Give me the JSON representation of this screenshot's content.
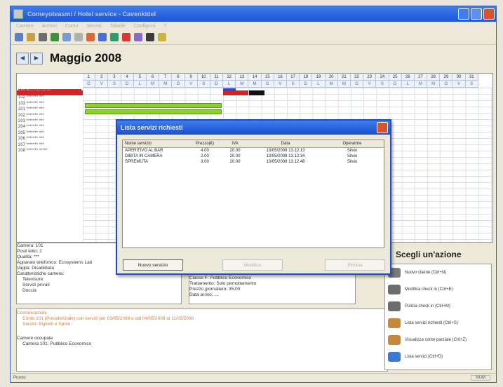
{
  "window": {
    "title": "Comeyoteasmi / Hotel service - Cavenkidel"
  },
  "menu": [
    "Camere",
    "Archivi",
    "Conto",
    "Servizi",
    "Tabelle",
    "Configura",
    "?"
  ],
  "calendar": {
    "month": "Maggio 2008",
    "days": [
      "1",
      "2",
      "3",
      "4",
      "5",
      "6",
      "7",
      "8",
      "9",
      "10",
      "11",
      "12",
      "13",
      "14",
      "15",
      "16",
      "17",
      "18",
      "19",
      "20",
      "21",
      "22",
      "23",
      "24",
      "25",
      "26",
      "27",
      "28",
      "29",
      "30",
      "31"
    ],
    "weekdays": [
      "G",
      "V",
      "S",
      "D",
      "L",
      "M",
      "M",
      "G",
      "V",
      "S",
      "D",
      "L",
      "M",
      "M",
      "G",
      "V",
      "S",
      "D",
      "L",
      "M",
      "M",
      "G",
      "V",
      "S",
      "D",
      "L",
      "M",
      "M",
      "G",
      "V",
      "S"
    ],
    "rooms": [
      "101 Presidenziale",
      "102 ******* ***",
      "103 ******* ***",
      "201 ******* ***",
      "202 ******* ***",
      "203 ******* ***",
      "204 ******* ***",
      "205 ******* ***",
      "206 ******* ***",
      "207 ******* ***",
      "208 ******* *****"
    ]
  },
  "room_info": {
    "lines": [
      "Camera: 101",
      "Posti letto: 2",
      "Qualità: ***",
      "Apparato telefonico: Ecosystems Lab",
      "Vaglia: Disabilitata",
      "Caratteristiche camera:",
      "Televisore",
      "Servizi privati",
      "Doccia"
    ],
    "stay_lines": [
      "Classe F: Pubblico Economico",
      "Trattamento: Solo pernottamento",
      "Prezzo giornaliero: 35.00",
      "Data arrivo: ...."
    ],
    "messages": [
      "Conto 101 (Presidenziale) con servizi per 03/05/2008 e dal 04/05/2008 al 11/05/2008",
      "Servizi: Biglietti e Sprite"
    ],
    "notice_label": "Comunicazioni",
    "occupied_label": "Camere occupate",
    "occupied_value": "Camera 101: Pubblico Economico"
  },
  "actions": {
    "title": "Scegli un'azione",
    "items": [
      "Nuovo cliente (Ctrl+N)",
      "Modifica check in (Ctrl+E)",
      "Pulizia check in (Ctrl+M)",
      "Lista servizi richiesti (Ctrl+S)",
      "Visualizza conto parziale (Ctrl+Z)",
      "Lista servizi (Ctrl+D)"
    ]
  },
  "status": {
    "left": "Pronto",
    "right": "NUM"
  },
  "dialog": {
    "title": "Lista servizi richiesti",
    "columns": [
      "Nome servizio",
      "Prezzo(€)",
      "IVA",
      "Data",
      "Operatore"
    ],
    "rows": [
      [
        "APERITIVO AL BAR",
        "4.00",
        "20.00",
        "13/05/2008 13.12.13",
        "Silvio"
      ],
      [
        "DIBITA IN CAMERA",
        "2.00",
        "20.00",
        "13/05/2008 13.12.34",
        "Silvio"
      ],
      [
        "SPREMUTA",
        "3.00",
        "20.00",
        "13/05/2008 13.12.48",
        "Silvio"
      ]
    ],
    "buttons": {
      "new": "Nuovo servizio",
      "edit": "Modifica",
      "delete": "Elimina"
    }
  },
  "colors": {
    "accent": "#1b55d6",
    "occupied_red": "#d62222",
    "stay_green": "#8fce2f"
  }
}
